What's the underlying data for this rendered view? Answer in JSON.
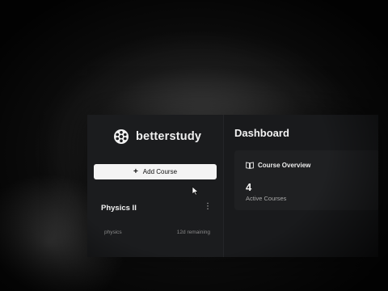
{
  "app": {
    "brand_name": "betterstudy"
  },
  "sidebar": {
    "add_course_label": "Add Course",
    "add_course_icon": "plus-icon",
    "courses": [
      {
        "title": "Physics II",
        "tag": "physics",
        "remaining": "12d remaining",
        "menu_icon": "more-vertical-icon"
      }
    ]
  },
  "main": {
    "title": "Dashboard",
    "overview": {
      "title": "Course Overview",
      "icon": "book-open-icon",
      "count": "4",
      "count_label": "Active Courses"
    }
  },
  "colors": {
    "app_background": "#191a1c",
    "sidebar_background": "#1b1c1e",
    "button_background": "#f4f4f4",
    "card_background": "#1f2022"
  }
}
